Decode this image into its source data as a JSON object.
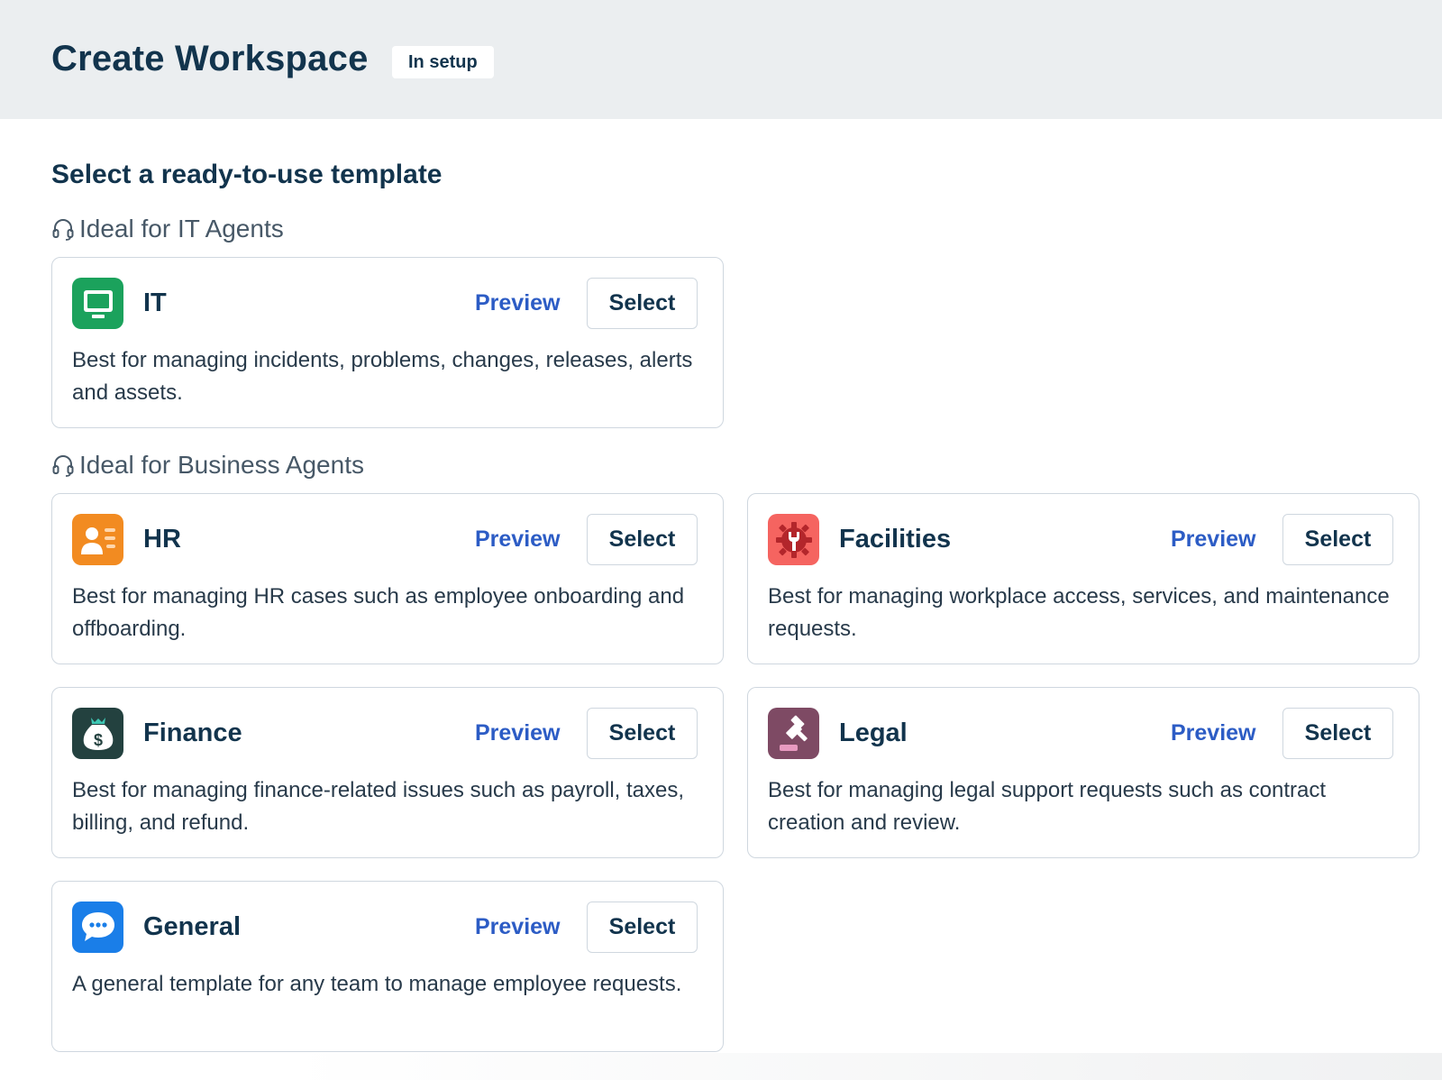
{
  "header": {
    "title": "Create Workspace",
    "status_badge": "In setup"
  },
  "main": {
    "section_heading": "Select a ready-to-use template",
    "groups": [
      {
        "label": "Ideal for IT Agents",
        "icon": "headset-icon",
        "templates": [
          {
            "name": "IT",
            "icon": "monitor-icon",
            "icon_color": "#1ba25c",
            "preview_label": "Preview",
            "select_label": "Select",
            "description": "Best for managing incidents, problems, changes, releases, alerts and assets."
          }
        ]
      },
      {
        "label": "Ideal for Business Agents",
        "icon": "headset-icon",
        "templates": [
          {
            "name": "HR",
            "icon": "id-card-icon",
            "icon_color": "#f28b21",
            "preview_label": "Preview",
            "select_label": "Select",
            "description": "Best for managing HR cases such as employee onboarding and offboarding."
          },
          {
            "name": "Facilities",
            "icon": "gear-wrench-icon",
            "icon_color": "#f56460",
            "preview_label": "Preview",
            "select_label": "Select",
            "description": "Best for managing workplace access, services, and maintenance requests."
          },
          {
            "name": "Finance",
            "icon": "money-bag-icon",
            "icon_color": "#23413f",
            "preview_label": "Preview",
            "select_label": "Select",
            "description": "Best for managing finance-related issues such as payroll, taxes, billing, and refund."
          },
          {
            "name": "Legal",
            "icon": "gavel-icon",
            "icon_color": "#7e4a64",
            "preview_label": "Preview",
            "select_label": "Select",
            "description": "Best for managing legal support requests such as contract creation and review."
          },
          {
            "name": "General",
            "icon": "chat-bubble-icon",
            "icon_color": "#1a7ee8",
            "preview_label": "Preview",
            "select_label": "Select",
            "description": "A general template for any team to manage employee requests."
          }
        ]
      }
    ]
  },
  "colors": {
    "header_bg": "#ebeef0",
    "link": "#2c5cc5",
    "text_primary": "#12344d",
    "border": "#cfd7df"
  }
}
